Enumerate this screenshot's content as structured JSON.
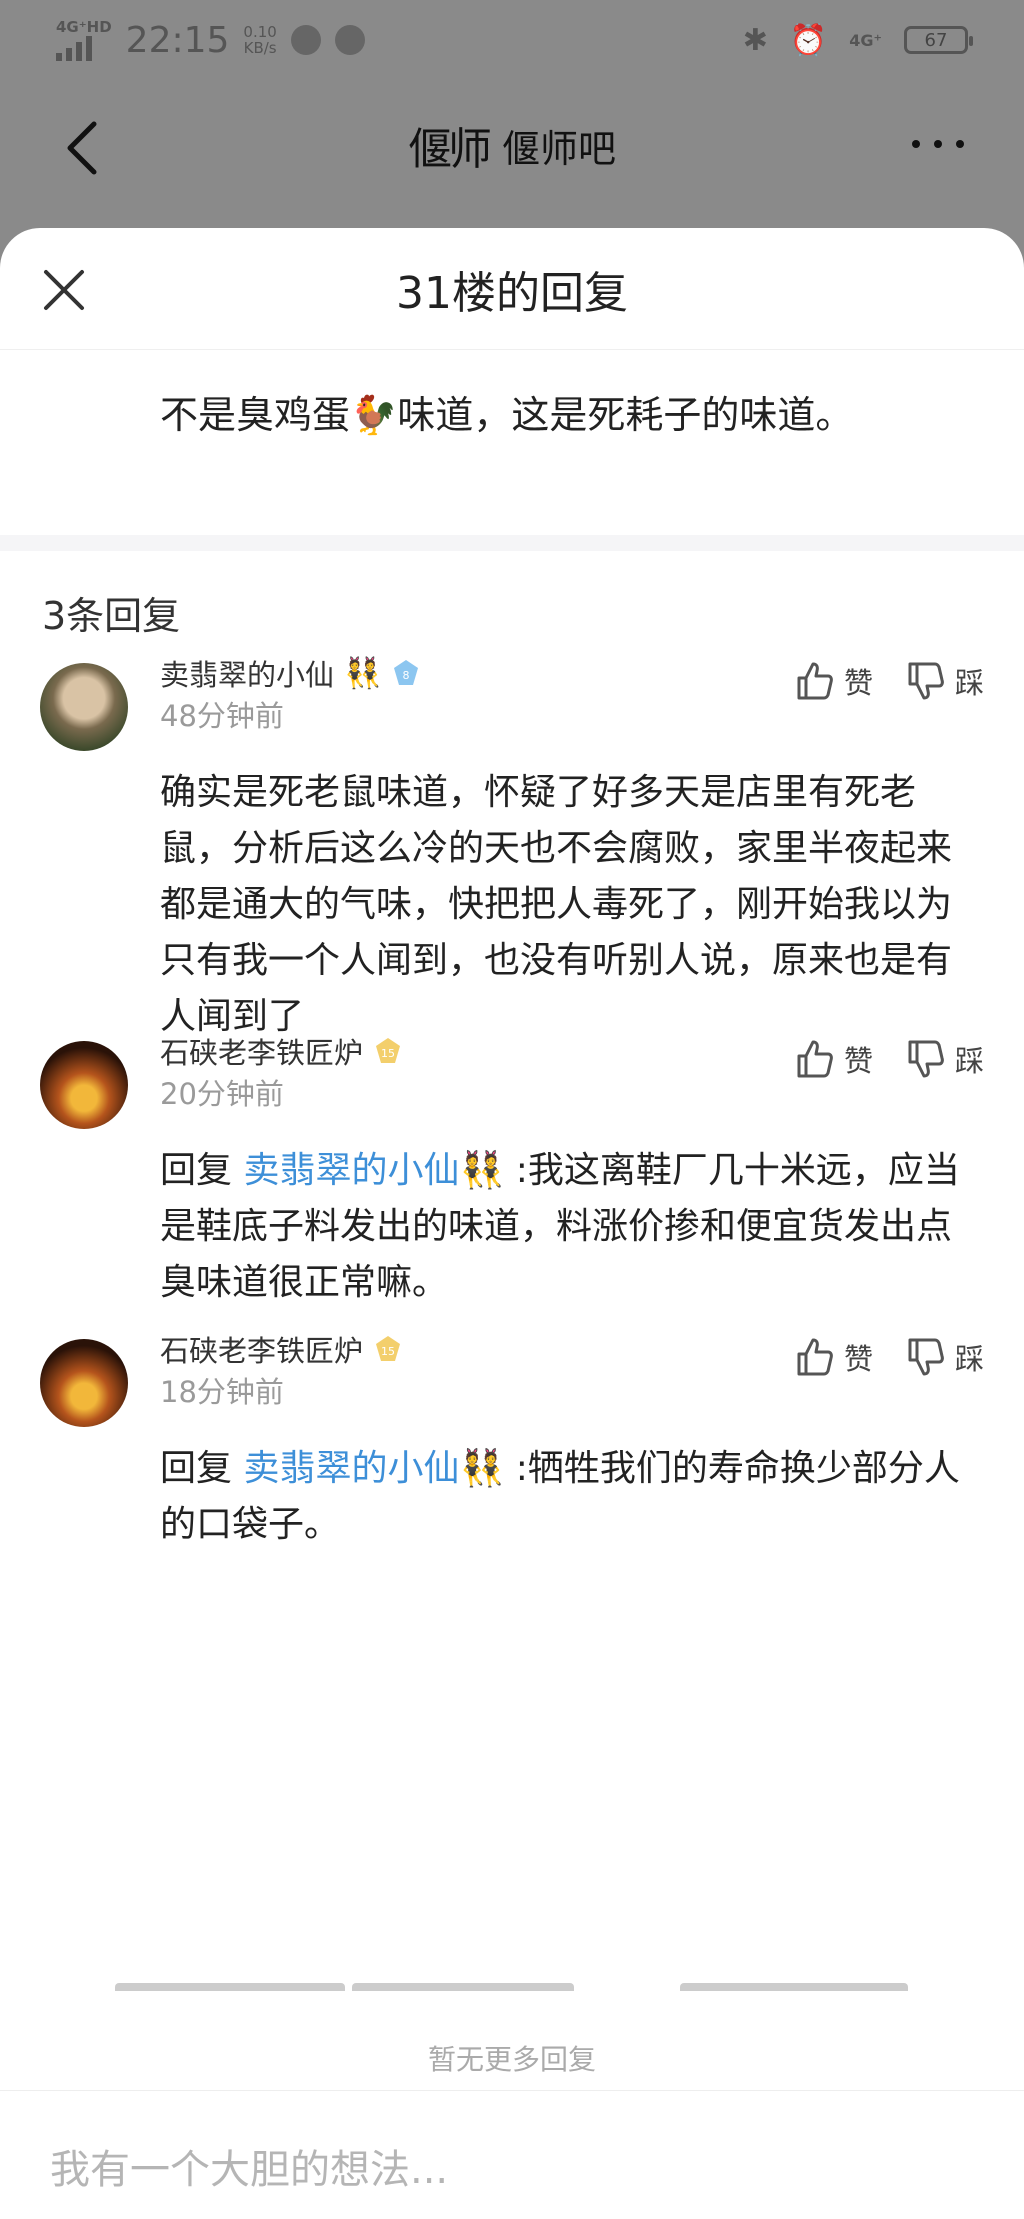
{
  "statusbar": {
    "network": "4G⁺HD",
    "time": "22:15",
    "speed_value": "0.10",
    "speed_unit": "KB/s",
    "network_right": "4G⁺",
    "battery": "67"
  },
  "navbar": {
    "logo_text": "偃师",
    "title": "偃师吧"
  },
  "sheet": {
    "title": "31楼的回复",
    "origin_text": "不是臭鸡蛋🐓味道，这是死耗子的味道。",
    "reply_count": "3条回复",
    "no_more": "暂无更多回复",
    "input_placeholder": "我有一个大胆的想法..."
  },
  "actions": {
    "like": "赞",
    "dislike": "踩"
  },
  "replies": [
    {
      "name": "卖翡翠的小仙",
      "emoji": "👯",
      "level": "8",
      "level_color": "#8cc6f0",
      "time": "48分钟前",
      "reply_prefix": "",
      "mention": "",
      "mention_emoji": "",
      "text": "确实是死老鼠味道，怀疑了好多天是店里有死老鼠，分析后这么冷的天也不会腐败，家里半夜起来都是通大的气味，快把把人毒死了，刚开始我以为只有我一个人闻到，也没有听别人说，原来也是有人闻到了"
    },
    {
      "name": "石硖老李铁匠炉",
      "emoji": "",
      "level": "15",
      "level_color": "#f3cf6c",
      "time": "20分钟前",
      "reply_prefix": "回复 ",
      "mention": "卖翡翠的小仙",
      "mention_emoji": "👯",
      "text": " :我这离鞋厂几十米远，应当是鞋底子料发出的味道，料涨价掺和便宜货发出点臭味道很正常嘛。"
    },
    {
      "name": "石硖老李铁匠炉",
      "emoji": "",
      "level": "15",
      "level_color": "#f3cf6c",
      "time": "18分钟前",
      "reply_prefix": "回复 ",
      "mention": "卖翡翠的小仙",
      "mention_emoji": "👯",
      "text": " :牺牲我们的寿命换少部分人的口袋子。"
    }
  ]
}
